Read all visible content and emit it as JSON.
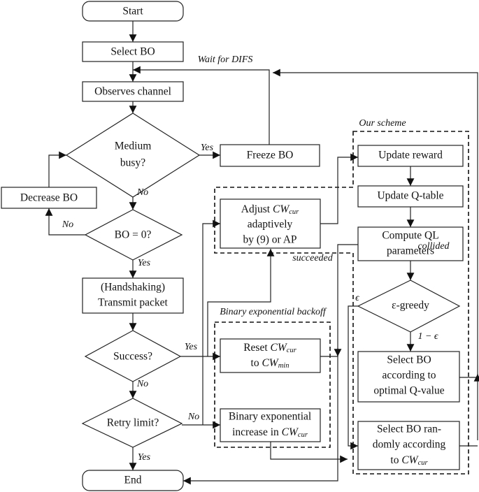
{
  "nodes": {
    "start": "Start",
    "select_bo": "Select BO",
    "observes": "Observes channel",
    "medium_busy": [
      "Medium",
      "busy?"
    ],
    "freeze": "Freeze BO",
    "decrease": "Decrease BO",
    "bo_zero": "BO = 0?",
    "transmit": [
      "(Handshaking)",
      "Transmit packet"
    ],
    "success": "Success?",
    "retry": "Retry limit?",
    "end": "End",
    "adjust": {
      "pre": "Adjust ",
      "cw": "CW",
      "sub": "cur",
      "l2": "adaptively",
      "l3": "by (9) or AP"
    },
    "reset": {
      "pre": "Reset ",
      "cw": "CW",
      "sub": "cur",
      "pre2": "to ",
      "cw2": "CW",
      "sub2": "min"
    },
    "binary": {
      "l1": "Binary exponential",
      "pre": "increase in ",
      "cw": "CW",
      "sub": "cur"
    },
    "update_reward": "Update reward",
    "update_q": "Update Q-table",
    "compute_ql": [
      "Compute QL",
      "parameters"
    ],
    "egreedy": "ε-greedy",
    "select_opt": [
      "Select BO",
      "according to",
      "optimal Q-value"
    ],
    "select_rand": {
      "l1": "Select BO ran-",
      "l2": "domly according",
      "pre": "to ",
      "cw": "CW",
      "sub": "cur"
    }
  },
  "labels": {
    "wait_difs": "Wait for DIFS",
    "our_scheme": "Our scheme",
    "beb": "Binary exponential backoff",
    "yes": "Yes",
    "no": "No",
    "succeeded": "succeeded",
    "collided": "collided",
    "epsilon": "ϵ",
    "one_minus_eps": "1 − ϵ"
  }
}
